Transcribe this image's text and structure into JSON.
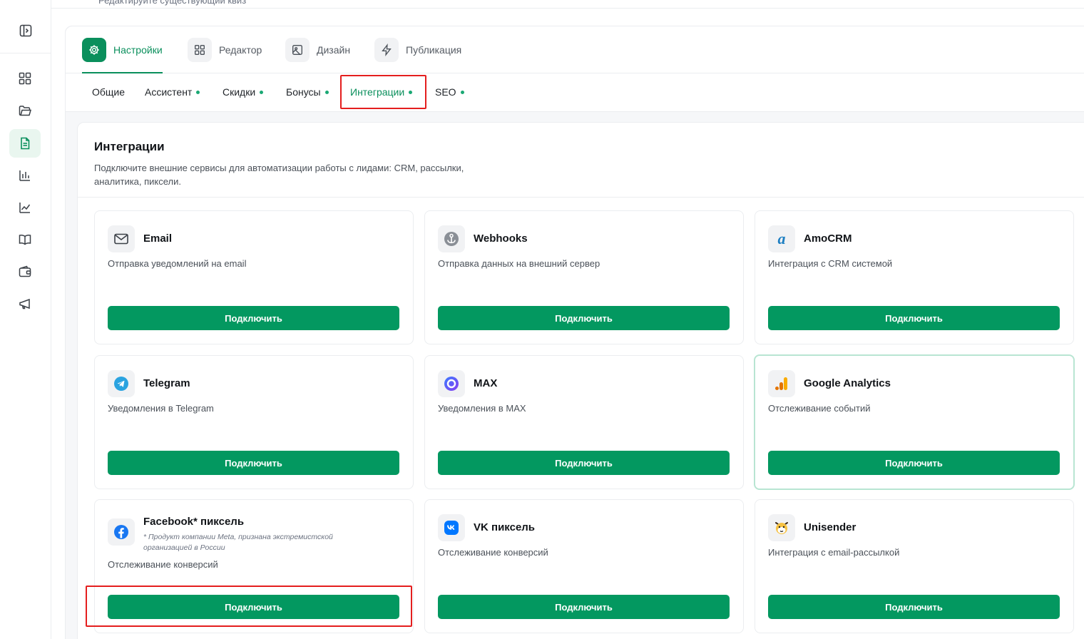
{
  "top_strip": {
    "text": "Редактируйте существующий квиз"
  },
  "main_tabs": [
    {
      "label": "Настройки",
      "icon": "gear-icon",
      "active": true
    },
    {
      "label": "Редактор",
      "icon": "grid-icon",
      "active": false
    },
    {
      "label": "Дизайн",
      "icon": "image-icon",
      "active": false
    },
    {
      "label": "Публикация",
      "icon": "lightning-icon",
      "active": false
    }
  ],
  "sub_tabs": [
    {
      "label": "Общие",
      "dot": false
    },
    {
      "label": "Ассистент",
      "dot": true
    },
    {
      "label": "Скидки",
      "dot": true
    },
    {
      "label": "Бонусы",
      "dot": true
    },
    {
      "label": "Интеграции",
      "dot": true,
      "active": true
    },
    {
      "label": "SEO",
      "dot": true
    }
  ],
  "section": {
    "title": "Интеграции",
    "description": "Подключите внешние сервисы для автоматизации работы с лидами: CRM, рассылки, аналитика, пиксели."
  },
  "integrations": [
    {
      "name": "Email",
      "description": "Отправка уведомлений на email",
      "icon": "mail-icon",
      "button": "Подключить"
    },
    {
      "name": "Webhooks",
      "description": "Отправка данных на внешний сервер",
      "icon": "webhook-icon",
      "button": "Подключить"
    },
    {
      "name": "AmoCRM",
      "description": "Интеграция с CRM системой",
      "icon": "amocrm-icon",
      "button": "Подключить"
    },
    {
      "name": "Telegram",
      "description": "Уведомления в Telegram",
      "icon": "telegram-icon",
      "button": "Подключить"
    },
    {
      "name": "MAX",
      "description": "Уведомления в MAX",
      "icon": "max-icon",
      "button": "Подключить"
    },
    {
      "name": "Google Analytics",
      "description": "Отслеживание событий",
      "icon": "google-analytics-icon",
      "button": "Подключить",
      "highlighted": true
    },
    {
      "name": "Facebook* пиксель",
      "note": "* Продукт компании Meta, признана экстремистской организацией в России",
      "description": "Отслеживание конверсий",
      "icon": "facebook-icon",
      "button": "Подключить"
    },
    {
      "name": "VK пиксель",
      "description": "Отслеживание конверсий",
      "icon": "vk-icon",
      "button": "Подключить"
    },
    {
      "name": "Unisender",
      "description": "Интеграция с email-рассылкой",
      "icon": "unisender-icon",
      "button": "Подключить"
    }
  ],
  "colors": {
    "accent": "#039860",
    "annotation": "#e41e1e",
    "active_nav_bg": "#e9f6ef"
  }
}
